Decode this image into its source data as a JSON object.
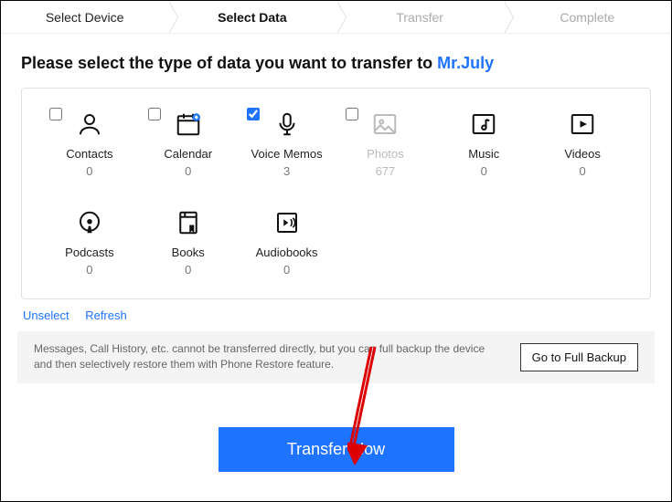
{
  "steps": {
    "s0": "Select Device",
    "s1": "Select Data",
    "s2": "Transfer",
    "s3": "Complete"
  },
  "prompt_prefix": "Please select the type of data you want to transfer to ",
  "device_name": "Mr.July",
  "tiles": {
    "contacts": {
      "label": "Contacts",
      "count": "0",
      "checked": false
    },
    "calendar": {
      "label": "Calendar",
      "count": "0",
      "checked": false
    },
    "voicememos": {
      "label": "Voice Memos",
      "count": "3",
      "checked": true
    },
    "photos": {
      "label": "Photos",
      "count": "677",
      "checked": false
    },
    "music": {
      "label": "Music",
      "count": "0",
      "checked": false
    },
    "videos": {
      "label": "Videos",
      "count": "0",
      "checked": false
    },
    "podcasts": {
      "label": "Podcasts",
      "count": "0",
      "checked": false
    },
    "books": {
      "label": "Books",
      "count": "0",
      "checked": false
    },
    "audiobooks": {
      "label": "Audiobooks",
      "count": "0",
      "checked": false
    }
  },
  "actions": {
    "unselect": "Unselect",
    "refresh": "Refresh"
  },
  "note_text": "Messages, Call History, etc. cannot be transferred directly, but you can full backup the device and then selectively restore them with Phone Restore feature.",
  "full_backup_btn": "Go to Full Backup",
  "primary_btn": "Transfer Now"
}
